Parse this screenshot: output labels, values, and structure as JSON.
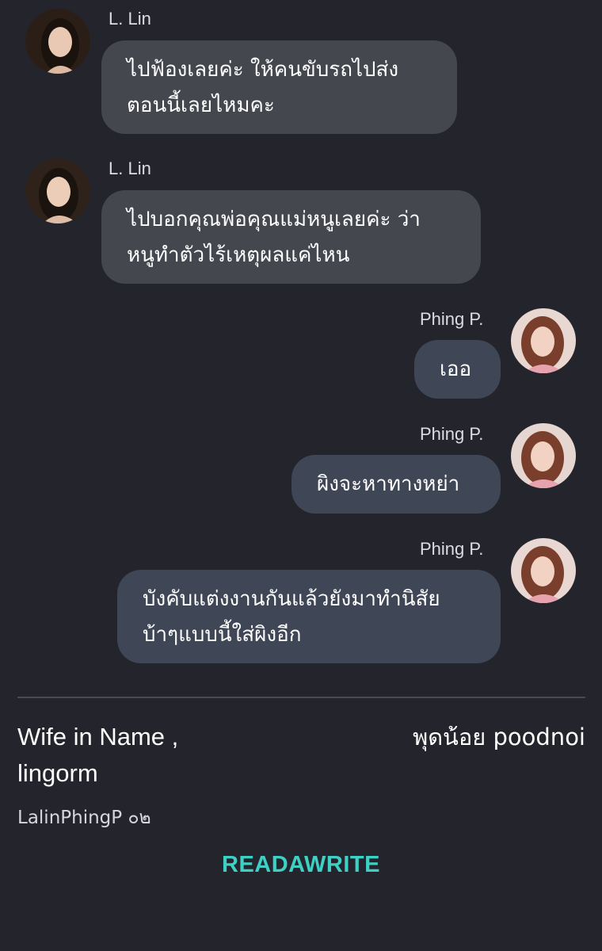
{
  "messages": [
    {
      "sender": "L. Lin",
      "side": "left",
      "lines": [
        "ไปฟ้องเลยค่ะ ให้คนขับรถไปส่ง",
        "ตอนนี้เลยไหมคะ"
      ]
    },
    {
      "sender": "L. Lin",
      "side": "left",
      "lines": [
        "ไปบอกคุณพ่อคุณแม่หนูเลยค่ะ ว่า",
        "หนูทำตัวไร้เหตุผลแค่ไหน"
      ]
    },
    {
      "sender": "Phing P.",
      "side": "right",
      "lines": [
        "เออ"
      ]
    },
    {
      "sender": "Phing P.",
      "side": "right",
      "lines": [
        "ผิงจะหาทางหย่า"
      ]
    },
    {
      "sender": "Phing P.",
      "side": "right",
      "lines": [
        "บังคับแต่งงานกันแล้วยังมาทำนิสัย",
        "บ้าๆแบบนี้ใส่ผิงอีก"
      ]
    }
  ],
  "footer": {
    "title_line1": "Wife in Name ,",
    "title_line2": "lingorm",
    "author": "พุดน้อย poodnoi",
    "chapter": "LalinPhingP ๐๒",
    "brand": "READAWRITE"
  },
  "colors": {
    "background": "#24252c",
    "bubble_incoming": "#45474f",
    "bubble_outgoing": "#3f4656",
    "brand": "#3ed0c4"
  },
  "icons": {
    "lin_avatar": "profile-photo-woman-dark-hair",
    "phing_avatar": "profile-photo-woman-auburn-hair"
  }
}
